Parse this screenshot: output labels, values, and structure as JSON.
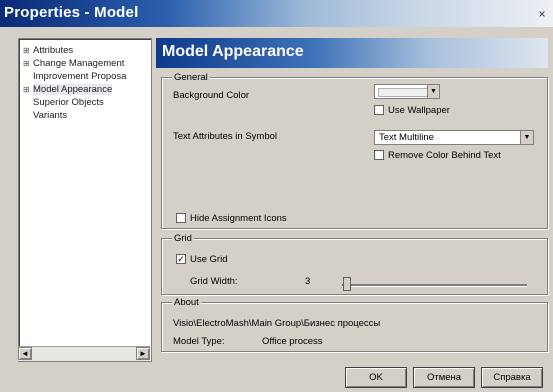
{
  "window": {
    "title": "Properties - Model",
    "close_glyph": "×"
  },
  "tree": {
    "items": [
      {
        "label": "Attributes",
        "expander": "⊞"
      },
      {
        "label": "Change Management",
        "expander": "⊞"
      },
      {
        "label": "Improvement Proposa",
        "expander": ""
      },
      {
        "label": "Model Appearance",
        "expander": "⊞"
      },
      {
        "label": "Superior Objects",
        "expander": ""
      },
      {
        "label": "Variants",
        "expander": ""
      }
    ],
    "scroll_left": "◄",
    "scroll_right": "►"
  },
  "panel": {
    "title": "Model Appearance"
  },
  "general": {
    "legend": "General",
    "background_color_label": "Background Color",
    "use_wallpaper_label": "Use Wallpaper",
    "use_wallpaper_checked": false,
    "text_attr_label": "Text Attributes in Symbol",
    "text_attr_value": "Text Multiline",
    "remove_color_label": "Remove Color Behind Text",
    "remove_color_checked": false,
    "hide_icons_label": "Hide Assignment Icons",
    "hide_icons_checked": false
  },
  "grid": {
    "legend": "Grid",
    "use_grid_label": "Use Grid",
    "use_grid_checked": true,
    "width_label": "Grid Width:",
    "width_value": "3",
    "slider_level": 0.0
  },
  "about": {
    "legend": "About",
    "path": "Visio\\ElectroMash\\Main Group\\Бизнес процессы",
    "model_type_label": "Model Type:",
    "model_type_value": "Office process"
  },
  "buttons": {
    "ok": "OK",
    "cancel": "Отмена",
    "help": "Справка"
  }
}
